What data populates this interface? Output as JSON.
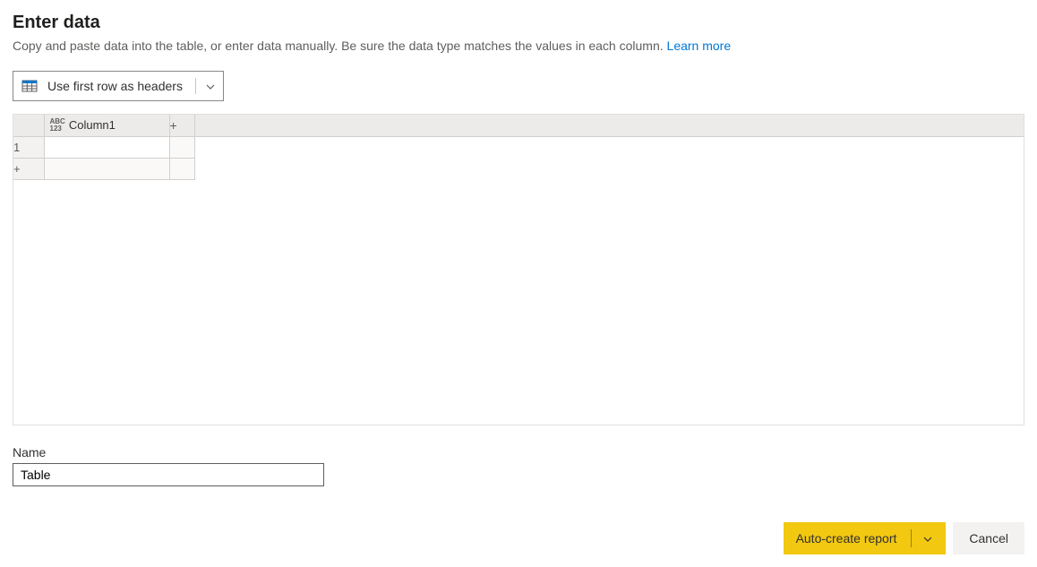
{
  "header": {
    "title": "Enter data",
    "subtitle_prefix": "Copy and paste data into the table, or enter data manually. Be sure the data type matches the values in each column. ",
    "learn_more": "Learn more"
  },
  "toolbar": {
    "use_headers_label": "Use first row as headers"
  },
  "grid": {
    "type_badge_top": "ABC",
    "type_badge_bottom": "123",
    "columns": [
      "Column1"
    ],
    "rows": [
      {
        "num": "1",
        "cells": [
          ""
        ]
      }
    ],
    "add_symbol": "+"
  },
  "name_field": {
    "label": "Name",
    "value": "Table"
  },
  "footer": {
    "primary_label": "Auto-create report",
    "cancel_label": "Cancel"
  }
}
